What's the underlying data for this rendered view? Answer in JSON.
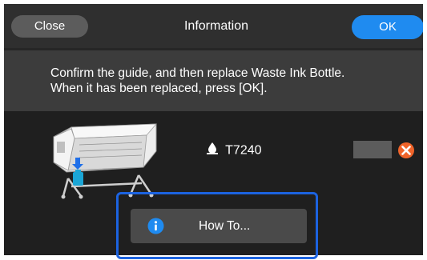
{
  "header": {
    "close_label": "Close",
    "title": "Information",
    "ok_label": "OK"
  },
  "message": {
    "line1": "Confirm the guide, and then replace Waste Ink Bottle.",
    "line2": "When it has been replaced, press [OK]."
  },
  "ink": {
    "icon": "ink-drop-icon",
    "model": "T7240",
    "status_icon": "error-x-icon"
  },
  "howto": {
    "icon": "info-icon",
    "label": "How To..."
  },
  "colors": {
    "ok_blue": "#1f8bf0",
    "highlight_blue": "#1c63e0",
    "error_orange": "#f0642a",
    "bottle_cyan": "#1ba6d6"
  }
}
